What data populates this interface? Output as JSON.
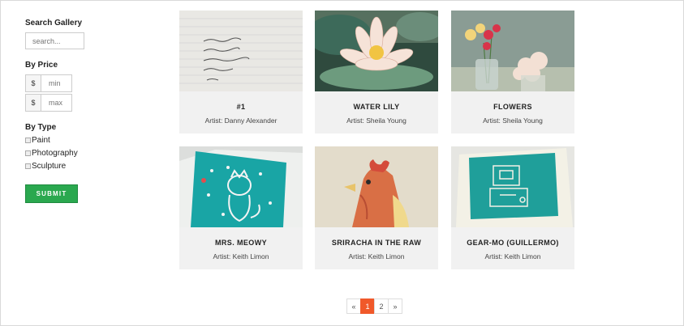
{
  "sidebar": {
    "search_heading": "Search Gallery",
    "search_placeholder": "search...",
    "price_heading": "By Price",
    "currency": "$",
    "min_placeholder": "min",
    "max_placeholder": "max",
    "type_heading": "By Type",
    "types": [
      "Paint",
      "Photography",
      "Sculpture"
    ],
    "submit_label": "SUBMIT"
  },
  "gallery": [
    {
      "title": "#1",
      "artist": "Artist: Danny Alexander",
      "image": "handwritten-note-image"
    },
    {
      "title": "WATER LILY",
      "artist": "Artist: Sheila Young",
      "image": "water-lily-image"
    },
    {
      "title": "FLOWERS",
      "artist": "Artist: Sheila Young",
      "image": "flowers-vase-image"
    },
    {
      "title": "MRS. MEOWY",
      "artist": "Artist: Keith Limon",
      "image": "cat-card-image"
    },
    {
      "title": "SRIRACHA IN THE RAW",
      "artist": "Artist: Keith Limon",
      "image": "rooster-image"
    },
    {
      "title": "GEAR-MO (GUILLERMO)",
      "artist": "Artist: Keith Limon",
      "image": "robot-card-image"
    }
  ],
  "pagination": {
    "prev": "«",
    "pages": [
      "1",
      "2"
    ],
    "next": "»",
    "current": "1"
  },
  "colors": {
    "submit": "#2aa84f",
    "active_page": "#f0592a",
    "card_bg": "#f1f1f1"
  }
}
